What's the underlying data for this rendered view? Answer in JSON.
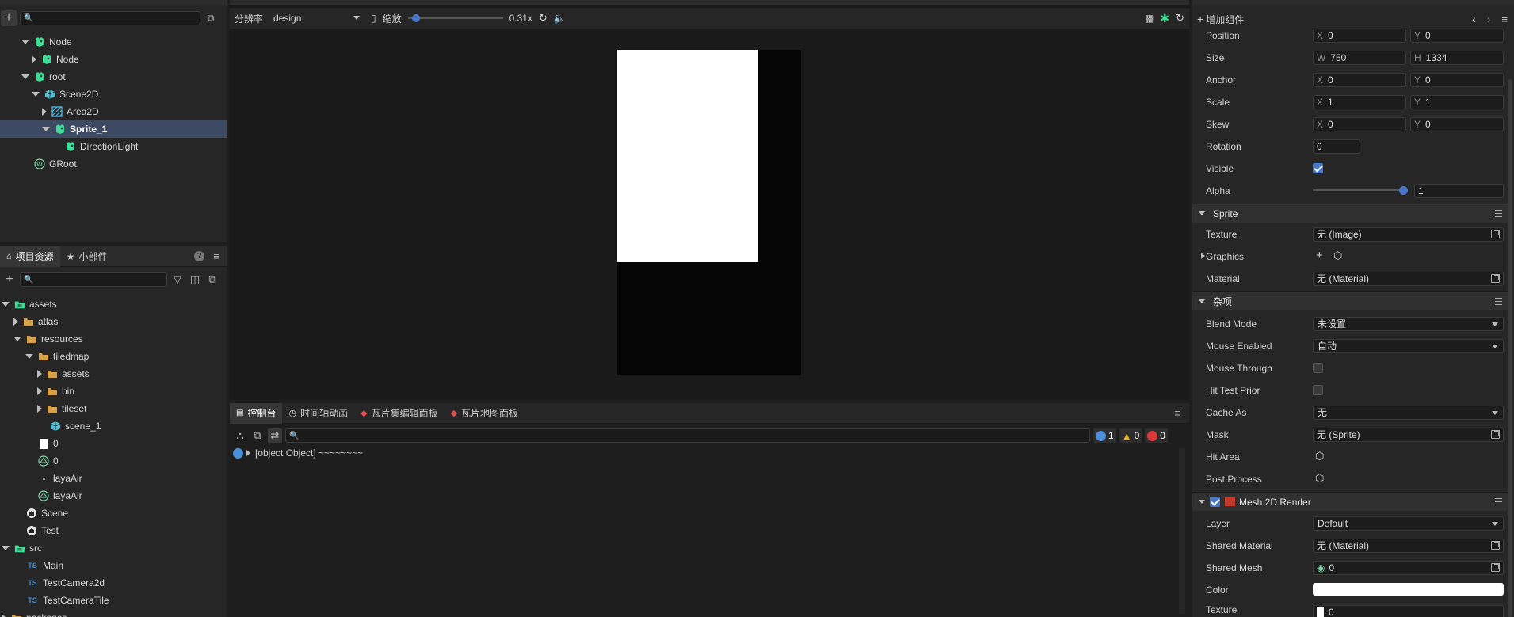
{
  "hierarchy": {
    "items": [
      {
        "label": "Node",
        "depth": 1,
        "exp": "down",
        "icon": "sprite-node-icon"
      },
      {
        "label": "Node",
        "depth": 2,
        "exp": "right",
        "icon": "sprite-node-icon"
      },
      {
        "label": "root",
        "depth": 1,
        "exp": "down",
        "icon": "sprite-node-icon"
      },
      {
        "label": "Scene2D",
        "depth": 2,
        "exp": "down",
        "icon": "scene-cube-icon"
      },
      {
        "label": "Area2D",
        "depth": 3,
        "exp": "right",
        "icon": "area-icon"
      },
      {
        "label": "Sprite_1",
        "depth": 3,
        "exp": "down",
        "icon": "sprite-node-icon",
        "selected": true
      },
      {
        "label": "DirectionLight",
        "depth": 4,
        "exp": "none",
        "icon": "sprite-node-icon"
      },
      {
        "label": "GRoot",
        "depth": 1,
        "exp": "none",
        "icon": "groot-icon"
      }
    ]
  },
  "assets_panel": {
    "tabs": [
      {
        "label": "项目资源"
      },
      {
        "label": "小部件"
      }
    ],
    "tree": [
      {
        "label": "assets",
        "depth": 0,
        "exp": "down",
        "icon": "green-folder-icon"
      },
      {
        "label": "atlas",
        "depth": 1,
        "exp": "right",
        "icon": "folder-icon"
      },
      {
        "label": "resources",
        "depth": 1,
        "exp": "down",
        "icon": "folder-icon"
      },
      {
        "label": "tiledmap",
        "depth": 2,
        "exp": "down",
        "icon": "folder-icon"
      },
      {
        "label": "assets",
        "depth": 3,
        "exp": "right",
        "icon": "folder-icon"
      },
      {
        "label": "bin",
        "depth": 3,
        "exp": "right",
        "icon": "folder-icon"
      },
      {
        "label": "tileset",
        "depth": 3,
        "exp": "right",
        "icon": "folder-icon"
      },
      {
        "label": "scene_1",
        "depth": 3,
        "exp": "none",
        "icon": "scene-cube-icon"
      },
      {
        "label": "0",
        "depth": 2,
        "exp": "none",
        "icon": "white-image-icon"
      },
      {
        "label": "0",
        "depth": 2,
        "exp": "none",
        "icon": "mesh-icon"
      },
      {
        "label": "layaAir",
        "depth": 2,
        "exp": "none",
        "icon": "dot-icon"
      },
      {
        "label": "layaAir",
        "depth": 2,
        "exp": "none",
        "icon": "mesh-icon"
      },
      {
        "label": "Scene",
        "depth": 1,
        "exp": "none",
        "icon": "scene-file-icon"
      },
      {
        "label": "Test",
        "depth": 1,
        "exp": "none",
        "icon": "scene-file-icon"
      },
      {
        "label": "src",
        "depth": 0,
        "exp": "down",
        "icon": "green-folder-icon"
      },
      {
        "label": "Main",
        "depth": 1,
        "exp": "none",
        "icon": "ts-icon"
      },
      {
        "label": "TestCamera2d",
        "depth": 1,
        "exp": "none",
        "icon": "ts-icon"
      },
      {
        "label": "TestCameraTile",
        "depth": 1,
        "exp": "none",
        "icon": "ts-icon"
      },
      {
        "label": "packages",
        "depth": 0,
        "exp": "right",
        "icon": "folder-icon"
      }
    ]
  },
  "viewport": {
    "resolution_label": "分辨率",
    "resolution_value": "design",
    "zoom_label": "缩放",
    "zoom_value": "0.31x",
    "zoom_fraction": 0.05
  },
  "console": {
    "tabs": [
      {
        "label": "控制台"
      },
      {
        "label": "时间轴动画"
      },
      {
        "label": "瓦片集编辑面板"
      },
      {
        "label": "瓦片地图面板"
      }
    ],
    "counts": {
      "info": "1",
      "warn": "0",
      "error": "0"
    },
    "log": "[object Object] ~~~~~~~~"
  },
  "inspector": {
    "add_component": "增加组件",
    "position": {
      "label": "Position",
      "x": "0",
      "y": "0"
    },
    "size": {
      "label": "Size",
      "w": "750",
      "h": "1334"
    },
    "anchor": {
      "label": "Anchor",
      "x": "0",
      "y": "0"
    },
    "scale": {
      "label": "Scale",
      "x": "1",
      "y": "1"
    },
    "skew": {
      "label": "Skew",
      "x": "0",
      "y": "0"
    },
    "rotation": {
      "label": "Rotation",
      "value": "0"
    },
    "visible": {
      "label": "Visible",
      "checked": true
    },
    "alpha": {
      "label": "Alpha",
      "value": "1",
      "fraction": 1
    },
    "sprite_section": "Sprite",
    "texture": {
      "label": "Texture",
      "value": "无 (Image)"
    },
    "graphics": {
      "label": "Graphics"
    },
    "material": {
      "label": "Material",
      "value": "无 (Material)"
    },
    "misc_section": "杂项",
    "blend_mode": {
      "label": "Blend Mode",
      "value": "未设置"
    },
    "mouse_enabled": {
      "label": "Mouse Enabled",
      "value": "自动"
    },
    "mouse_through": {
      "label": "Mouse Through",
      "checked": false
    },
    "hit_test_prior": {
      "label": "Hit Test Prior",
      "checked": false
    },
    "cache_as": {
      "label": "Cache As",
      "value": "无"
    },
    "mask": {
      "label": "Mask",
      "value": "无 (Sprite)"
    },
    "hit_area": {
      "label": "Hit Area"
    },
    "post_process": {
      "label": "Post Process"
    },
    "mesh_section": "Mesh 2D Render",
    "layer": {
      "label": "Layer",
      "value": "Default"
    },
    "shared_material": {
      "label": "Shared Material",
      "value": "无 (Material)"
    },
    "shared_mesh": {
      "label": "Shared Mesh",
      "value": "0"
    },
    "color": {
      "label": "Color",
      "value": "#ffffff"
    },
    "texture2": {
      "label": "Texture",
      "value": "0"
    }
  },
  "colors": {
    "accent": "#4a78c8",
    "selection": "#3d4a63",
    "node_green": "#3ddc97"
  }
}
